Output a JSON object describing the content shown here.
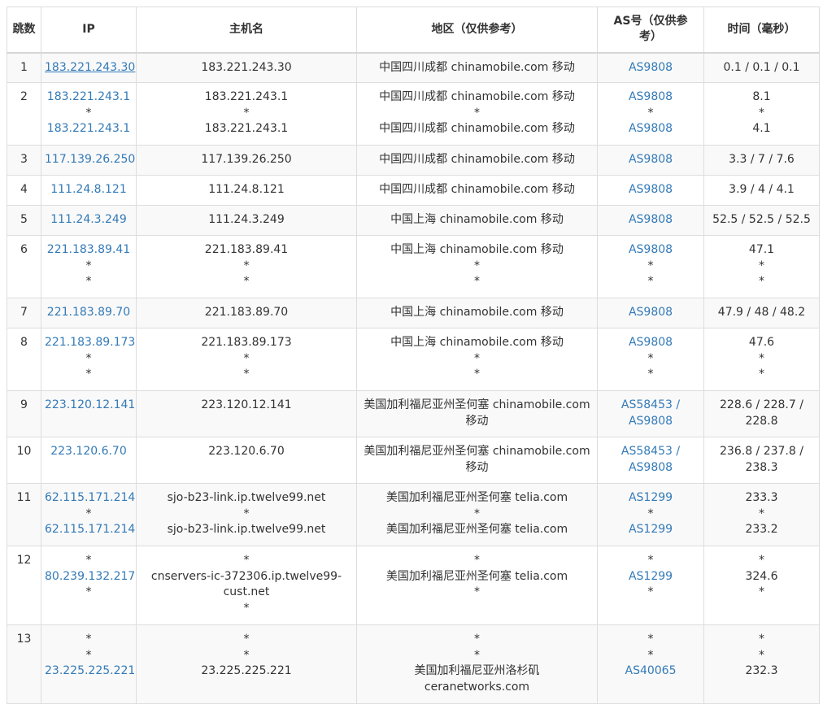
{
  "headers": {
    "hop": "跳数",
    "ip": "IP",
    "hostname": "主机名",
    "region": "地区（仅供参考）",
    "as": "AS号（仅供参考）",
    "time": "时间（毫秒）"
  },
  "rows": [
    {
      "hop": "1",
      "ip": [
        "183.221.243.30"
      ],
      "host": [
        "183.221.243.30"
      ],
      "region": [
        "中国四川成都 chinamobile.com 移动"
      ],
      "as": [
        "AS9808"
      ],
      "time": [
        "0.1 / 0.1 / 0.1"
      ]
    },
    {
      "hop": "2",
      "ip": [
        "183.221.243.1",
        "*",
        "183.221.243.1"
      ],
      "host": [
        "183.221.243.1",
        "*",
        "183.221.243.1"
      ],
      "region": [
        "中国四川成都 chinamobile.com 移动",
        "*",
        "中国四川成都 chinamobile.com 移动"
      ],
      "as": [
        "AS9808",
        "*",
        "AS9808"
      ],
      "time": [
        "8.1",
        "*",
        "4.1"
      ]
    },
    {
      "hop": "3",
      "ip": [
        "117.139.26.250"
      ],
      "host": [
        "117.139.26.250"
      ],
      "region": [
        "中国四川成都 chinamobile.com 移动"
      ],
      "as": [
        "AS9808"
      ],
      "time": [
        "3.3 / 7 / 7.6"
      ]
    },
    {
      "hop": "4",
      "ip": [
        "111.24.8.121"
      ],
      "host": [
        "111.24.8.121"
      ],
      "region": [
        "中国四川成都 chinamobile.com 移动"
      ],
      "as": [
        "AS9808"
      ],
      "time": [
        "3.9 / 4 / 4.1"
      ]
    },
    {
      "hop": "5",
      "ip": [
        "111.24.3.249"
      ],
      "host": [
        "111.24.3.249"
      ],
      "region": [
        "中国上海 chinamobile.com 移动"
      ],
      "as": [
        "AS9808"
      ],
      "time": [
        "52.5 / 52.5 / 52.5"
      ]
    },
    {
      "hop": "6",
      "ip": [
        "221.183.89.41",
        "*",
        "*"
      ],
      "host": [
        "221.183.89.41",
        "*",
        "*"
      ],
      "region": [
        "中国上海 chinamobile.com 移动",
        "*",
        "*"
      ],
      "as": [
        "AS9808",
        "*",
        "*"
      ],
      "time": [
        "47.1",
        "*",
        "*"
      ]
    },
    {
      "hop": "7",
      "ip": [
        "221.183.89.70"
      ],
      "host": [
        "221.183.89.70"
      ],
      "region": [
        "中国上海 chinamobile.com 移动"
      ],
      "as": [
        "AS9808"
      ],
      "time": [
        "47.9 / 48 / 48.2"
      ]
    },
    {
      "hop": "8",
      "ip": [
        "221.183.89.173",
        "*",
        "*"
      ],
      "host": [
        "221.183.89.173",
        "*",
        "*"
      ],
      "region": [
        "中国上海 chinamobile.com 移动",
        "*",
        "*"
      ],
      "as": [
        "AS9808",
        "*",
        "*"
      ],
      "time": [
        "47.6",
        "*",
        "*"
      ]
    },
    {
      "hop": "9",
      "ip": [
        "223.120.12.141"
      ],
      "host": [
        "223.120.12.141"
      ],
      "region": [
        "美国加利福尼亚州圣何塞 chinamobile.com 移动"
      ],
      "as": [
        "AS58453 / AS9808"
      ],
      "time": [
        "228.6 / 228.7 / 228.8"
      ]
    },
    {
      "hop": "10",
      "ip": [
        "223.120.6.70"
      ],
      "host": [
        "223.120.6.70"
      ],
      "region": [
        "美国加利福尼亚州圣何塞 chinamobile.com 移动"
      ],
      "as": [
        "AS58453 / AS9808"
      ],
      "time": [
        "236.8 / 237.8 / 238.3"
      ]
    },
    {
      "hop": "11",
      "ip": [
        "62.115.171.214",
        "*",
        "62.115.171.214"
      ],
      "host": [
        "sjo-b23-link.ip.twelve99.net",
        "*",
        "sjo-b23-link.ip.twelve99.net"
      ],
      "region": [
        "美国加利福尼亚州圣何塞 telia.com",
        "*",
        "美国加利福尼亚州圣何塞 telia.com"
      ],
      "as": [
        "AS1299",
        "*",
        "AS1299"
      ],
      "time": [
        "233.3",
        "*",
        "233.2"
      ]
    },
    {
      "hop": "12",
      "ip": [
        "*",
        "80.239.132.217",
        "*"
      ],
      "host": [
        "*",
        "cnservers-ic-372306.ip.twelve99-cust.net",
        "*"
      ],
      "region": [
        "*",
        "美国加利福尼亚州圣何塞 telia.com",
        "*"
      ],
      "as": [
        "*",
        "AS1299",
        "*"
      ],
      "time": [
        "*",
        "324.6",
        "*"
      ]
    },
    {
      "hop": "13",
      "ip": [
        "*",
        "*",
        "23.225.225.221"
      ],
      "host": [
        "*",
        "*",
        "23.225.225.221"
      ],
      "region": [
        "*",
        "*",
        "美国加利福尼亚州洛杉矶 ceranetworks.com"
      ],
      "as": [
        "*",
        "*",
        "AS40065"
      ],
      "time": [
        "*",
        "*",
        "232.3"
      ]
    }
  ]
}
